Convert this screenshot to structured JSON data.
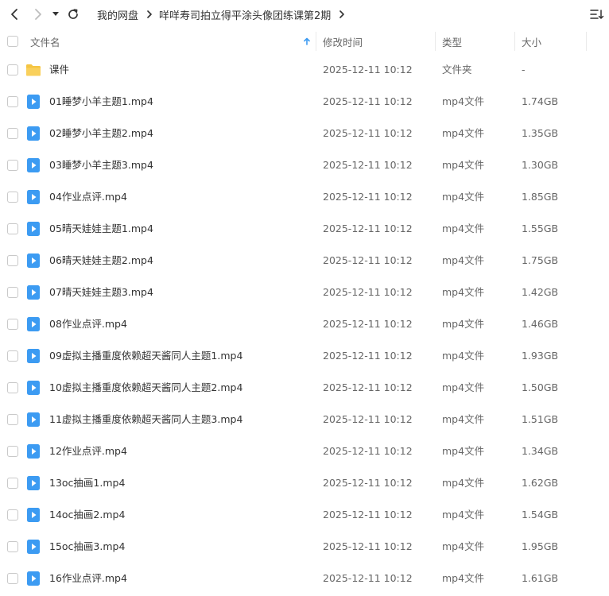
{
  "breadcrumb": {
    "root": "我的网盘",
    "current": "咩咩寿司拍立得平涂头像团练课第2期"
  },
  "columns": {
    "name": "文件名",
    "modified": "修改时间",
    "type": "类型",
    "size": "大小"
  },
  "colors": {
    "folder": "#F5C542",
    "video": "#3C9BF2",
    "sort_arrow": "#3C9BF2"
  },
  "files": [
    {
      "name": "课件",
      "modified": "2025-12-11 10:12",
      "type": "文件夹",
      "size": "-",
      "icon": "folder-icon"
    },
    {
      "name": "01睡梦小羊主题1.mp4",
      "modified": "2025-12-11 10:12",
      "type": "mp4文件",
      "size": "1.74GB",
      "icon": "video-file-icon"
    },
    {
      "name": "02睡梦小羊主题2.mp4",
      "modified": "2025-12-11 10:12",
      "type": "mp4文件",
      "size": "1.35GB",
      "icon": "video-file-icon"
    },
    {
      "name": "03睡梦小羊主题3.mp4",
      "modified": "2025-12-11 10:12",
      "type": "mp4文件",
      "size": "1.30GB",
      "icon": "video-file-icon"
    },
    {
      "name": "04作业点评.mp4",
      "modified": "2025-12-11 10:12",
      "type": "mp4文件",
      "size": "1.85GB",
      "icon": "video-file-icon"
    },
    {
      "name": "05晴天娃娃主题1.mp4",
      "modified": "2025-12-11 10:12",
      "type": "mp4文件",
      "size": "1.55GB",
      "icon": "video-file-icon"
    },
    {
      "name": "06晴天娃娃主题2.mp4",
      "modified": "2025-12-11 10:12",
      "type": "mp4文件",
      "size": "1.75GB",
      "icon": "video-file-icon"
    },
    {
      "name": "07晴天娃娃主题3.mp4",
      "modified": "2025-12-11 10:12",
      "type": "mp4文件",
      "size": "1.42GB",
      "icon": "video-file-icon"
    },
    {
      "name": "08作业点评.mp4",
      "modified": "2025-12-11 10:12",
      "type": "mp4文件",
      "size": "1.46GB",
      "icon": "video-file-icon"
    },
    {
      "name": "09虚拟主播重度依赖超天酱同人主题1.mp4",
      "modified": "2025-12-11 10:12",
      "type": "mp4文件",
      "size": "1.93GB",
      "icon": "video-file-icon"
    },
    {
      "name": "10虚拟主播重度依赖超天酱同人主题2.mp4",
      "modified": "2025-12-11 10:12",
      "type": "mp4文件",
      "size": "1.50GB",
      "icon": "video-file-icon"
    },
    {
      "name": "11虚拟主播重度依赖超天酱同人主题3.mp4",
      "modified": "2025-12-11 10:12",
      "type": "mp4文件",
      "size": "1.51GB",
      "icon": "video-file-icon"
    },
    {
      "name": "12作业点评.mp4",
      "modified": "2025-12-11 10:12",
      "type": "mp4文件",
      "size": "1.34GB",
      "icon": "video-file-icon"
    },
    {
      "name": "13oc抽画1.mp4",
      "modified": "2025-12-11 10:12",
      "type": "mp4文件",
      "size": "1.62GB",
      "icon": "video-file-icon"
    },
    {
      "name": "14oc抽画2.mp4",
      "modified": "2025-12-11 10:12",
      "type": "mp4文件",
      "size": "1.54GB",
      "icon": "video-file-icon"
    },
    {
      "name": "15oc抽画3.mp4",
      "modified": "2025-12-11 10:12",
      "type": "mp4文件",
      "size": "1.95GB",
      "icon": "video-file-icon"
    },
    {
      "name": "16作业点评.mp4",
      "modified": "2025-12-11 10:12",
      "type": "mp4文件",
      "size": "1.61GB",
      "icon": "video-file-icon"
    }
  ]
}
